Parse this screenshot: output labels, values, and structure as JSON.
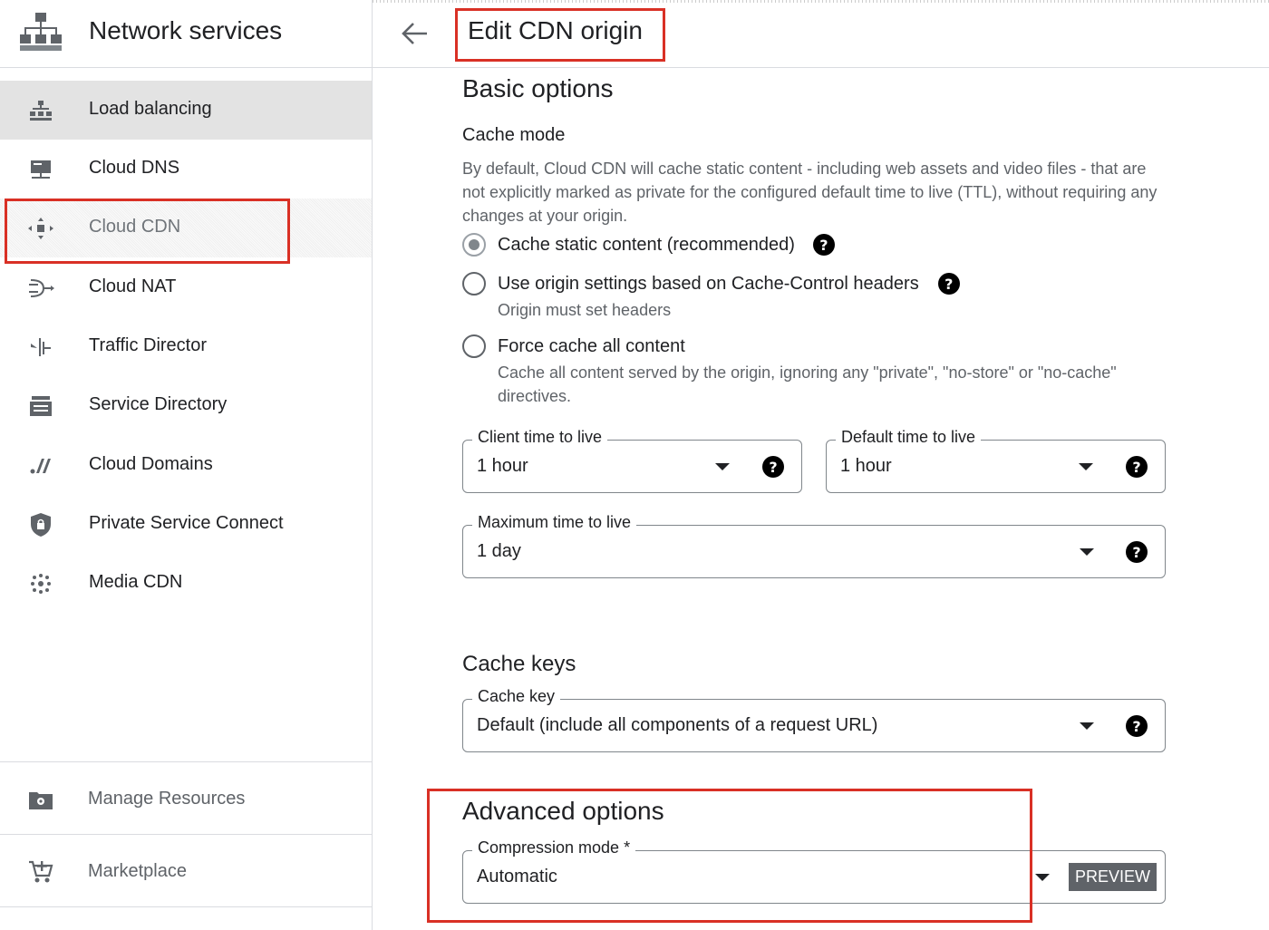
{
  "sidebar": {
    "title": "Network services",
    "items": [
      {
        "label": "Load balancing",
        "icon": "load-balancing-icon"
      },
      {
        "label": "Cloud DNS",
        "icon": "cloud-dns-icon"
      },
      {
        "label": "Cloud CDN",
        "icon": "cloud-cdn-icon"
      },
      {
        "label": "Cloud NAT",
        "icon": "cloud-nat-icon"
      },
      {
        "label": "Traffic Director",
        "icon": "traffic-director-icon"
      },
      {
        "label": "Service Directory",
        "icon": "service-directory-icon"
      },
      {
        "label": "Cloud Domains",
        "icon": "cloud-domains-icon"
      },
      {
        "label": "Private Service Connect",
        "icon": "private-service-connect-icon"
      },
      {
        "label": "Media CDN",
        "icon": "media-cdn-icon"
      }
    ],
    "bottom": [
      {
        "label": "Manage Resources",
        "icon": "manage-resources-icon"
      },
      {
        "label": "Marketplace",
        "icon": "marketplace-icon"
      }
    ]
  },
  "header": {
    "title": "Edit CDN origin"
  },
  "basic": {
    "title": "Basic options",
    "cache_mode": {
      "title": "Cache mode",
      "description": "By default, Cloud CDN will cache static content - including web assets and video files - that are not explicitly marked as private for the configured default time to live (TTL), without requiring any changes at your origin.",
      "options": [
        {
          "label": "Cache static content (recommended)",
          "checked": true
        },
        {
          "label": "Use origin settings based on Cache-Control headers",
          "hint": "Origin must set headers",
          "checked": false
        },
        {
          "label": "Force cache all content",
          "hint": "Cache all content served by the origin, ignoring any \"private\", \"no-store\" or \"no-cache\" directives.",
          "checked": false
        }
      ]
    },
    "client_ttl": {
      "label": "Client time to live",
      "value": "1 hour"
    },
    "default_ttl": {
      "label": "Default time to live",
      "value": "1 hour"
    },
    "max_ttl": {
      "label": "Maximum time to live",
      "value": "1 day"
    }
  },
  "cache_keys": {
    "title": "Cache keys",
    "field": {
      "label": "Cache key",
      "value": "Default (include all components of a request URL)"
    }
  },
  "advanced": {
    "title": "Advanced options",
    "compression": {
      "label": "Compression mode *",
      "value": "Automatic",
      "badge": "PREVIEW"
    }
  },
  "icons": {
    "help": "?",
    "back": "arrow-left-icon"
  },
  "colors": {
    "highlight": "#d93025",
    "active_bg": "#e3e3e3"
  }
}
